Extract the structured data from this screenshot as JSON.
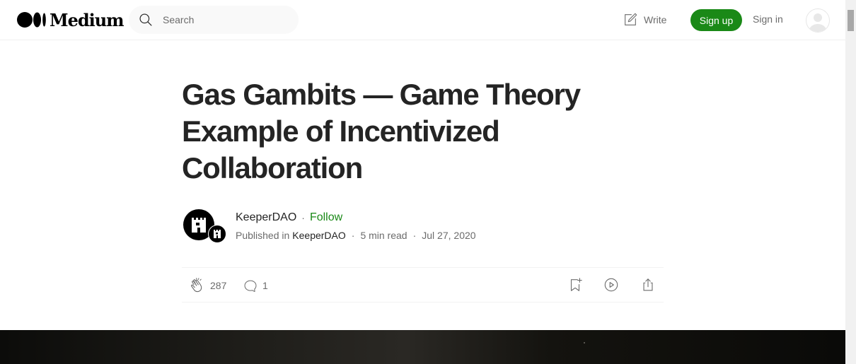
{
  "header": {
    "logo_text": "Medium",
    "search": {
      "placeholder": "Search",
      "value": "",
      "icon": "search-icon"
    },
    "write_label": "Write",
    "signup_label": "Sign up",
    "signin_label": "Sign in"
  },
  "article": {
    "title": "Gas Gambits — Game Theory Example of Incentivized Collaboration",
    "author": {
      "name": "KeeperDAO",
      "follow_label": "Follow"
    },
    "meta": {
      "published_in_label": "Published in",
      "publication": "KeeperDAO",
      "read_time": "5 min read",
      "date": "Jul 27, 2020"
    },
    "actions": {
      "claps": "287",
      "responses": "1"
    }
  },
  "colors": {
    "accent": "#1a8917",
    "text": "#242424",
    "muted": "#6b6b6b"
  }
}
